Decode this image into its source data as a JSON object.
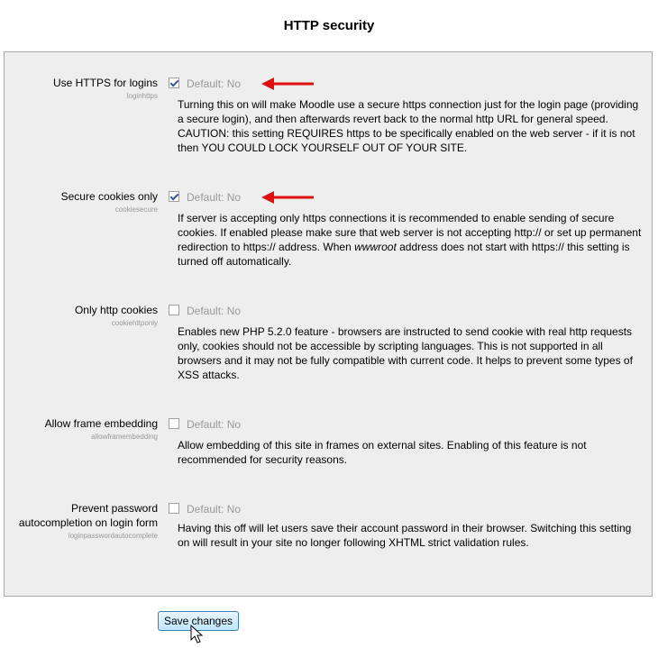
{
  "page": {
    "title": "HTTP security"
  },
  "settings": [
    {
      "label": "Use HTTPS for logins",
      "key": "loginhttps",
      "checked": true,
      "default": "Default: No",
      "description": "Turning this on will make Moodle use a secure https connection just for the login page (providing a secure login), and then afterwards revert back to the normal http URL for general speed. CAUTION: this setting REQUIRES https to be specifically enabled on the web server - if it is not then YOU COULD LOCK YOURSELF OUT OF YOUR SITE."
    },
    {
      "label": "Secure cookies only",
      "key": "cookiesecure",
      "checked": true,
      "default": "Default: No",
      "description_before": "If server is accepting only https connections it is recommended to enable sending of secure cookies. If enabled please make sure that web server is not accepting http:// or set up permanent redirection to https:// address. When ",
      "description_emphasis": "wwwroot",
      "description_after": " address does not start with https:// this setting is turned off automatically."
    },
    {
      "label": "Only http cookies",
      "key": "cookiehttponly",
      "checked": false,
      "default": "Default: No",
      "description": "Enables new PHP 5.2.0 feature - browsers are instructed to send cookie with real http requests only, cookies should not be accessible by scripting languages. This is not supported in all browsers and it may not be fully compatible with current code. It helps to prevent some types of XSS attacks."
    },
    {
      "label": "Allow frame embedding",
      "key": "allowframembedding",
      "checked": false,
      "default": "Default: No",
      "description": "Allow embedding of this site in frames on external sites. Enabling of this feature is not recommended for security reasons."
    },
    {
      "label": "Prevent password autocompletion on login form",
      "key": "loginpasswordautocomplete",
      "checked": false,
      "default": "Default: No",
      "description": "Having this off will let users save their account password in their browser. Switching this setting on will result in your site no longer following XHTML strict validation rules."
    }
  ],
  "actions": {
    "save_label": "Save changes"
  },
  "colors": {
    "annotation_arrow": "#e01010",
    "panel_background": "#eeeeee",
    "muted_text": "#999999"
  },
  "icons": {
    "annotation": "red-arrow-icon",
    "pointer": "mouse-cursor-icon"
  }
}
